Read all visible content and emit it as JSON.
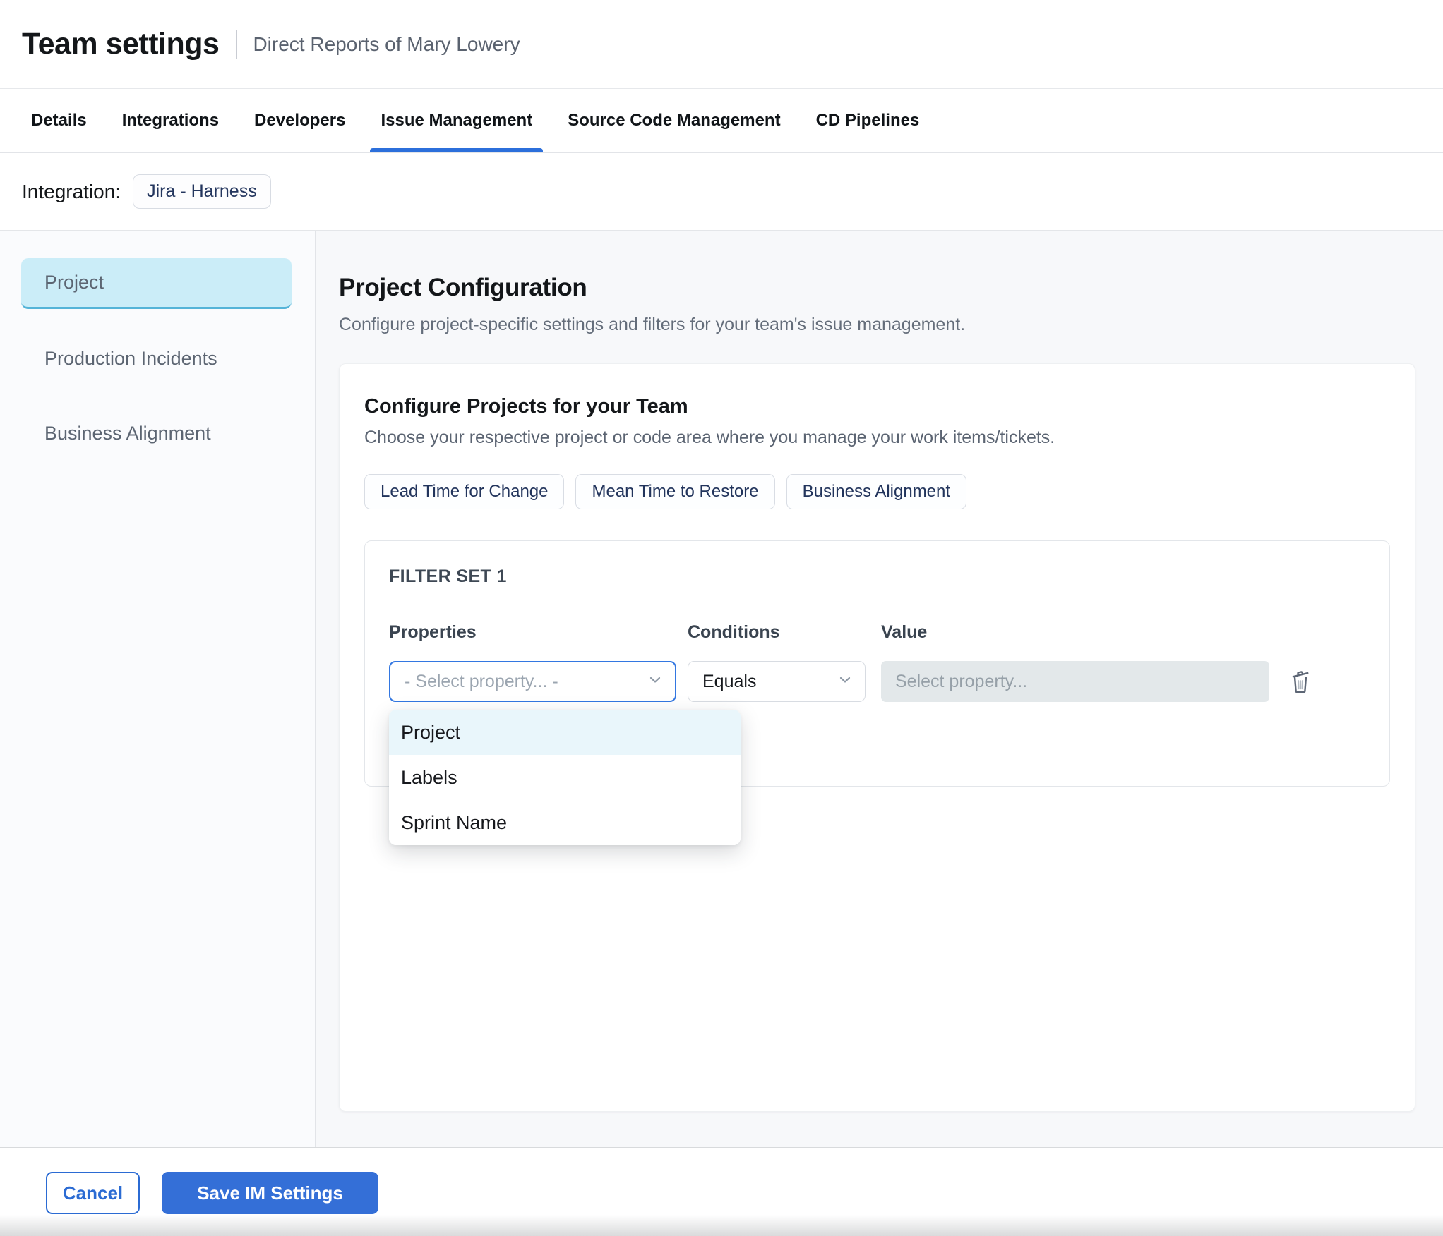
{
  "header": {
    "title": "Team settings",
    "subtitle": "Direct Reports of Mary Lowery"
  },
  "tabs": {
    "active": "Issue Management",
    "items": [
      {
        "label": "Details"
      },
      {
        "label": "Integrations"
      },
      {
        "label": "Developers"
      },
      {
        "label": "Issue Management"
      },
      {
        "label": "Source Code Management"
      },
      {
        "label": "CD Pipelines"
      }
    ]
  },
  "integration": {
    "label": "Integration:",
    "chip": "Jira - Harness"
  },
  "sidebar": {
    "active": "Project",
    "items": [
      {
        "label": "Project"
      },
      {
        "label": "Production Incidents"
      },
      {
        "label": "Business Alignment"
      }
    ]
  },
  "main": {
    "title": "Project Configuration",
    "subtitle": "Configure project-specific settings and filters for your team's issue management.",
    "card": {
      "title": "Configure Projects for your Team",
      "subtitle": "Choose your respective project or code area where you manage your work items/tickets.",
      "chips": [
        {
          "label": "Lead Time for Change"
        },
        {
          "label": "Mean Time to Restore"
        },
        {
          "label": "Business Alignment"
        }
      ],
      "filter_set": {
        "title": "FILTER SET 1",
        "columns": {
          "properties": "Properties",
          "conditions": "Conditions",
          "value": "Value"
        },
        "property_placeholder": "- Select property... -",
        "condition_value": "Equals",
        "value_placeholder": "Select property...",
        "dropdown": {
          "highlighted": "Project",
          "options": [
            {
              "label": "Project"
            },
            {
              "label": "Labels"
            },
            {
              "label": "Sprint Name"
            }
          ]
        }
      }
    }
  },
  "footer": {
    "cancel_label": "Cancel",
    "save_label": "Save IM Settings"
  },
  "colors": {
    "accent_blue": "#2c6fdb",
    "save_button": "#346fd7",
    "sidebar_active_bg": "#cbedf8",
    "sidebar_active_border": "#55b4d8",
    "dropdown_highlight": "#e9f6fb",
    "focus_border": "#3377e1",
    "value_field_bg": "#e3e8ea"
  }
}
